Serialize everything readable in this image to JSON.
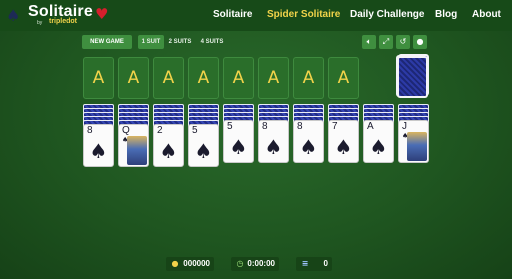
{
  "header": {
    "logo_title": "Solitaire",
    "logo_by": "by",
    "logo_brand": "tripledot",
    "nav": [
      "Solitaire",
      "Spider Solitaire",
      "Daily Challenge",
      "Blog",
      "About"
    ],
    "active_nav": "Spider Solitaire"
  },
  "toolbar": {
    "new_game": "NEW GAME",
    "suits": [
      "1 SUIT",
      "2 SUITS",
      "4 SUITS"
    ],
    "active_suit": "1 SUIT",
    "icons": [
      "volume-icon",
      "fullscreen-icon",
      "undo-icon",
      "hint-icon"
    ]
  },
  "foundations": [
    "A",
    "A",
    "A",
    "A",
    "A",
    "A",
    "A",
    "A"
  ],
  "tableau": [
    {
      "rank": "8",
      "suit": "♠"
    },
    {
      "rank": "Q",
      "suit": "♠",
      "face": true
    },
    {
      "rank": "2",
      "suit": "♠"
    },
    {
      "rank": "5",
      "suit": "♠"
    },
    {
      "rank": "5",
      "suit": "♠"
    },
    {
      "rank": "8",
      "suit": "♠"
    },
    {
      "rank": "8",
      "suit": "♠"
    },
    {
      "rank": "7",
      "suit": "♠"
    },
    {
      "rank": "A",
      "suit": "♠"
    },
    {
      "rank": "J",
      "suit": "♠",
      "face": true
    }
  ],
  "status": {
    "score": "000000",
    "time": "0:00:00",
    "moves": "0"
  },
  "colors": {
    "felt": "#1f5620",
    "accent": "#f1d34a",
    "button": "#3f8f3f",
    "card_back": "#2b3a9a"
  }
}
